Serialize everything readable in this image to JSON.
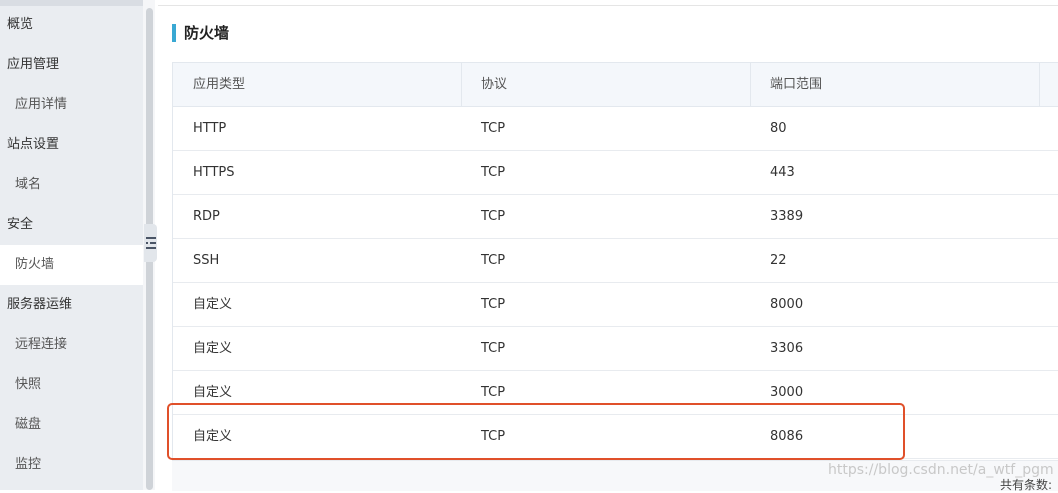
{
  "sidebar": {
    "items": [
      {
        "label": "概览",
        "level": "group"
      },
      {
        "label": "应用管理",
        "level": "group"
      },
      {
        "label": "应用详情",
        "level": "sub"
      },
      {
        "label": "站点设置",
        "level": "group"
      },
      {
        "label": "域名",
        "level": "sub"
      },
      {
        "label": "安全",
        "level": "group"
      },
      {
        "label": "防火墙",
        "level": "sub",
        "active": true
      },
      {
        "label": "服务器运维",
        "level": "group"
      },
      {
        "label": "远程连接",
        "level": "sub"
      },
      {
        "label": "快照",
        "level": "sub"
      },
      {
        "label": "磁盘",
        "level": "sub"
      },
      {
        "label": "监控",
        "level": "sub"
      }
    ]
  },
  "main": {
    "title": "防火墙",
    "table": {
      "headers": [
        "应用类型",
        "协议",
        "端口范围"
      ],
      "rows": [
        [
          "HTTP",
          "TCP",
          "80"
        ],
        [
          "HTTPS",
          "TCP",
          "443"
        ],
        [
          "RDP",
          "TCP",
          "3389"
        ],
        [
          "SSH",
          "TCP",
          "22"
        ],
        [
          "自定义",
          "TCP",
          "8000"
        ],
        [
          "自定义",
          "TCP",
          "3306"
        ],
        [
          "自定义",
          "TCP",
          "3000"
        ],
        [
          "自定义",
          "TCP",
          "8086"
        ]
      ]
    },
    "footer_total": "共有条数:",
    "watermark": "https://blog.csdn.net/a_wtf_pgm"
  },
  "colors": {
    "accent": "#39a8d3",
    "highlight": "#e0502a",
    "sidebar_bg": "#eaedf1",
    "header_bg": "#f4f7fb"
  }
}
